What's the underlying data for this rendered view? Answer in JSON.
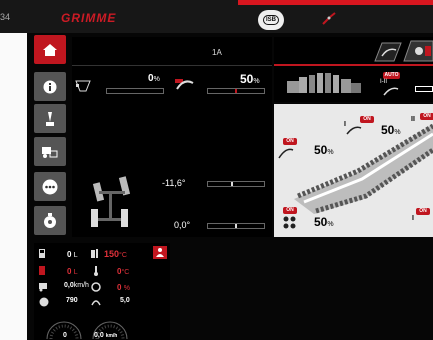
{
  "header": {
    "row_number": "34",
    "brand": "GRIMME",
    "isb_label": "ISB"
  },
  "sidebar": {
    "items": [
      {
        "name": "home",
        "active": true
      },
      {
        "name": "info",
        "active": false
      },
      {
        "name": "lever",
        "active": false
      },
      {
        "name": "machine",
        "active": false
      },
      {
        "name": "more",
        "active": false
      },
      {
        "name": "timer",
        "active": false
      }
    ]
  },
  "main": {
    "top_label": "1A",
    "hopper": {
      "value": "0",
      "unit": "%",
      "level": 0
    },
    "adjust": {
      "value": "50",
      "unit": "%",
      "level": 0.5
    },
    "angle1": {
      "value": "-11,6",
      "unit": "°",
      "level": 0.42
    },
    "angle2": {
      "value": "0,0",
      "unit": "°",
      "level": 0.5
    }
  },
  "right": {
    "auto_label": "AUTO",
    "roman_label": "I-II",
    "on_label": "ON",
    "roman_1": "I",
    "roman_2": "II",
    "val_top": "50",
    "val_mid": "50",
    "val_bottom": "50",
    "unit": "%"
  },
  "bottom": {
    "fuel": {
      "value": "0",
      "unit": "L"
    },
    "oil_temp": {
      "value": "150",
      "unit": "°C"
    },
    "adblue": {
      "value": "0",
      "unit": "L"
    },
    "coolant": {
      "value": "0",
      "unit": "°C"
    },
    "speed": {
      "value": "0,0",
      "unit": "km/h"
    },
    "slip": {
      "value": "0",
      "unit": "%"
    },
    "rpm": {
      "value": "790"
    },
    "pressure": {
      "value": "5,0"
    },
    "gauge1": {
      "value": "0"
    },
    "gauge2": {
      "value": "0,0"
    },
    "gauge2_unit": "km/h"
  },
  "colors": {
    "accent": "#c0161f",
    "panel": "#000000",
    "background": "#060606"
  }
}
